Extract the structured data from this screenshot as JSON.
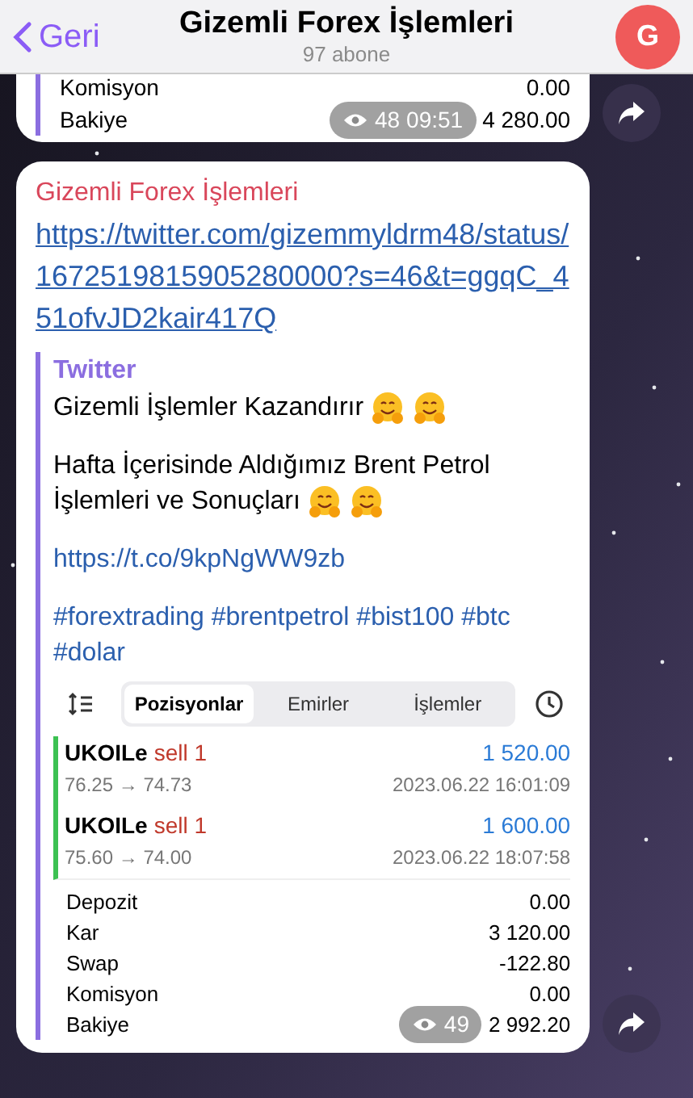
{
  "header": {
    "back_label": "Geri",
    "title": "Gizemli Forex İşlemleri",
    "subtitle": "97 abone",
    "avatar_letter": "G"
  },
  "previous_message": {
    "rows": [
      {
        "label": "Komisyon",
        "value": "0.00"
      },
      {
        "label": "Bakiye",
        "value": "4 280.00"
      }
    ],
    "views": "48",
    "time": "09:51"
  },
  "message": {
    "sender": "Gizemli Forex İşlemleri",
    "link": "https://twitter.com/gizemmyldrm48/status/1672519815905280000?s=46&t=ggqC_451ofvJD2kair417Q",
    "preview": {
      "site": "Twitter",
      "blocks": [
        {
          "kind": "text",
          "text": "Gizemli İşlemler Kazandırır",
          "emoji": [
            {
              "kind": "hugging"
            },
            {
              "kind": "hugging"
            }
          ]
        },
        {
          "kind": "text",
          "text": "Hafta İçerisinde Aldığımız Brent Petrol İşlemleri ve Sonuçları",
          "emoji": [
            {
              "kind": "hugging"
            },
            {
              "kind": "hugging"
            }
          ]
        },
        {
          "kind": "link",
          "text": "https://t.co/9kpNgWW9zb"
        },
        {
          "kind": "link",
          "text": "#forextrading #brentpetrol #bist100 #btc #dolar"
        }
      ],
      "screenshot": {
        "tabs": [
          {
            "label": "Pozisyonlar",
            "selected": true
          },
          {
            "label": "Emirler",
            "selected": false
          },
          {
            "label": "İşlemler",
            "selected": false
          }
        ],
        "positions": [
          {
            "symbol": "UKOILe",
            "side": "sell 1",
            "prices": "76.25 → 74.73",
            "profit": "1 520.00",
            "time": "2023.06.22 16:01:09"
          },
          {
            "symbol": "UKOILe",
            "side": "sell 1",
            "prices": "75.60 → 74.00",
            "profit": "1 600.00",
            "time": "2023.06.22 18:07:58"
          }
        ],
        "summary": [
          {
            "label": "Depozit",
            "value": "0.00"
          },
          {
            "label": "Kar",
            "value": "3 120.00"
          },
          {
            "label": "Swap",
            "value": "-122.80"
          },
          {
            "label": "Komisyon",
            "value": "0.00"
          },
          {
            "label": "Bakiye",
            "value": "2 992.20"
          }
        ]
      }
    },
    "views": "49"
  }
}
